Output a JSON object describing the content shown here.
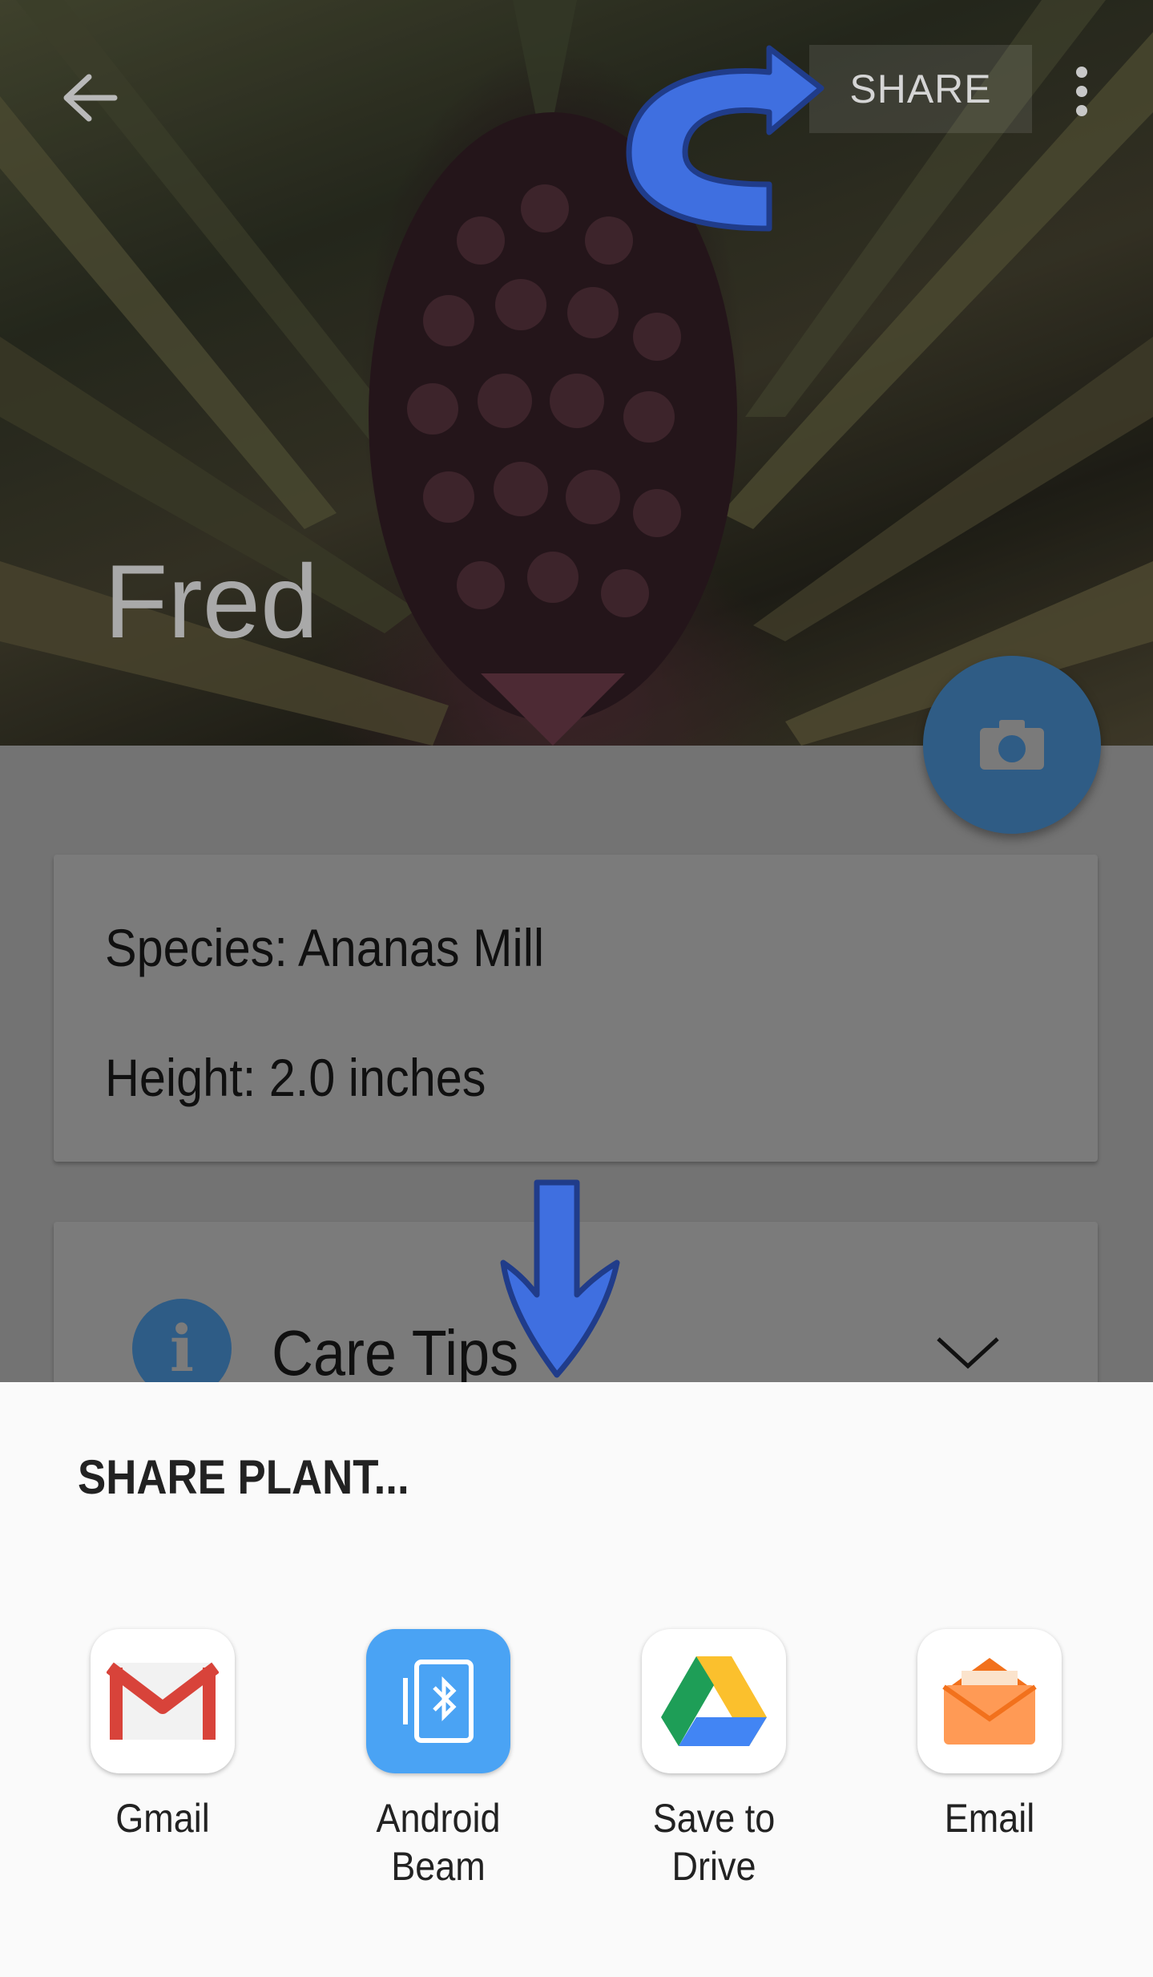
{
  "toolbar": {
    "share_label": "SHARE"
  },
  "plant": {
    "name": "Fred",
    "species": "Species: Ananas Mill",
    "height": "Height: 2.0 inches"
  },
  "care_tips": {
    "label": "Care Tips"
  },
  "share_sheet": {
    "title": "SHARE PLANT...",
    "apps": [
      {
        "label": "Gmail"
      },
      {
        "label_line1": "Android",
        "label_line2": "Beam"
      },
      {
        "label": "Save to Drive"
      },
      {
        "label": "Email"
      }
    ]
  },
  "colors": {
    "accent_blue": "#3f6fe0",
    "fab": "#2f5c85",
    "sheet_bg": "#fafafa"
  },
  "icons": [
    "back-arrow-icon",
    "overflow-menu-icon",
    "camera-icon",
    "info-icon",
    "chevron-down-icon",
    "gmail-icon",
    "android-beam-icon",
    "drive-icon",
    "email-icon"
  ]
}
